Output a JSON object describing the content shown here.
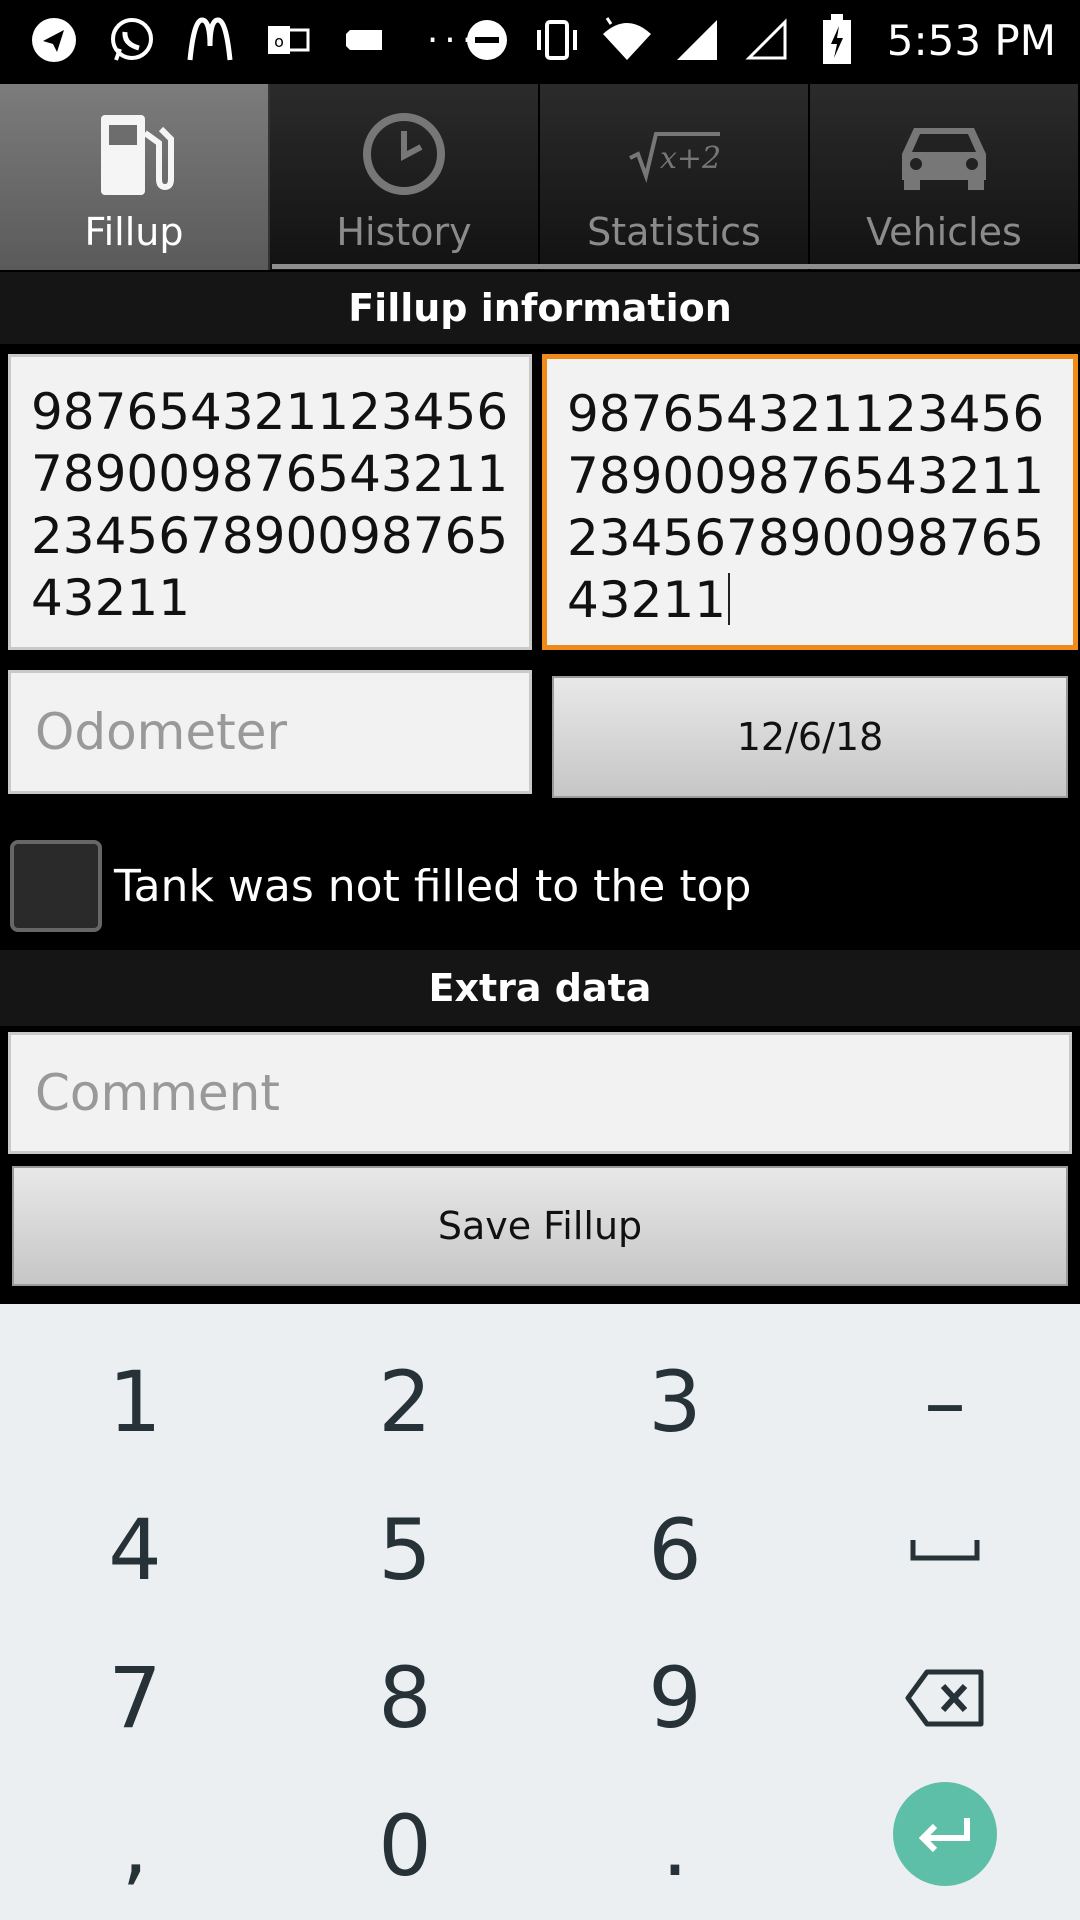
{
  "status_bar": {
    "time": "5:53 PM",
    "dots": "···",
    "left_icons": [
      "telegram-icon",
      "whatsapp-icon",
      "mcdonalds-icon",
      "outlook-icon",
      "label-icon"
    ],
    "right_icons": [
      "dnd-icon",
      "vibrate-icon",
      "wifi-icon",
      "signal-icon",
      "signal-empty-icon",
      "battery-charging-icon"
    ]
  },
  "tabs": [
    {
      "label": "Fillup",
      "icon": "fuel-pump-icon",
      "active": true
    },
    {
      "label": "History",
      "icon": "clock-icon",
      "active": false
    },
    {
      "label": "Statistics",
      "icon": "sqrt-icon",
      "active": false
    },
    {
      "label": "Vehicles",
      "icon": "car-icon",
      "active": false
    }
  ],
  "fillup": {
    "header": "Fillup information",
    "field1_value": "98765432112345678900987654321123456789009876543211",
    "field2_value": "98765432112345678900987654321123456789009876543211",
    "odometer_placeholder": "Odometer",
    "date_button": "12/6/18",
    "tank_label": "Tank was not filled to the top"
  },
  "extra": {
    "header": "Extra data",
    "comment_placeholder": "Comment",
    "save_button": "Save Fillup"
  },
  "keyboard": {
    "keys": [
      "1",
      "2",
      "3",
      "–",
      "4",
      "5",
      "6",
      "␣",
      "7",
      "8",
      "9",
      "backspace",
      ",",
      "0",
      ".",
      "enter"
    ],
    "accent": "#5ebfa9"
  },
  "colors": {
    "focus_border": "#f08a18"
  }
}
